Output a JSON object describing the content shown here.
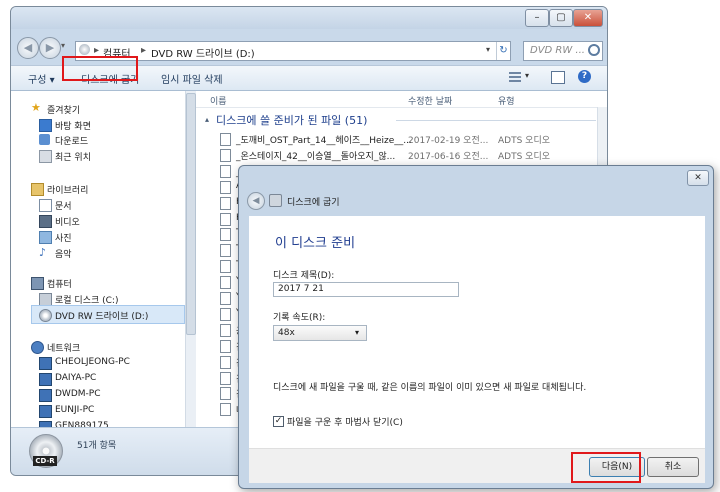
{
  "explorer": {
    "address_parts": [
      "컴퓨터",
      "DVD RW 드라이브 (D:)"
    ],
    "address_sep": "▸",
    "search_placeholder": "DVD RW ...",
    "toolbar": {
      "organize": "구성 ▾",
      "burn": "디스크에 굽기",
      "delete_temp": "임시 파일 삭제"
    },
    "nav": {
      "favorites": {
        "label": "즐겨찾기",
        "items": [
          "바탕 화면",
          "다운로드",
          "최근 위치"
        ]
      },
      "libraries": {
        "label": "라이브러리",
        "items": [
          "문서",
          "비디오",
          "사진",
          "음악"
        ]
      },
      "computer": {
        "label": "컴퓨터",
        "items": [
          "로컬 디스크 (C:)",
          "DVD RW 드라이브 (D:)"
        ]
      },
      "network": {
        "label": "네트워크",
        "items": [
          "CHEOLJEONG-PC",
          "DAIYA-PC",
          "DWDM-PC",
          "EUNJI-PC",
          "GEN889175"
        ]
      }
    },
    "columns": {
      "name": "이름",
      "modified": "수정한 날짜",
      "type": "유형"
    },
    "group_header": "디스크에 쓸 준비가 된 파일 (51)",
    "files": [
      {
        "name": "_도깨비_OST_Part_14__헤이즈__Heize__...",
        "date": "2017-02-19 오전...",
        "type": "ADTS 오디오"
      },
      {
        "name": "_온스테이지_42__이승열__돌아오지_않...",
        "date": "2017-06-16 오전...",
        "type": "ADTS 오디오"
      },
      {
        "name": "_응",
        "date": "",
        "type": ""
      },
      {
        "name": "An",
        "date": "",
        "type": ""
      },
      {
        "name": "Hu",
        "date": "",
        "type": ""
      },
      {
        "name": "Kin",
        "date": "",
        "type": ""
      },
      {
        "name": "The",
        "date": "",
        "type": ""
      },
      {
        "name": "The",
        "date": "",
        "type": ""
      },
      {
        "name": "The",
        "date": "",
        "type": ""
      },
      {
        "name": "Yin",
        "date": "",
        "type": ""
      },
      {
        "name": "You",
        "date": "",
        "type": ""
      },
      {
        "name": "You",
        "date": "",
        "type": ""
      },
      {
        "name": "공항",
        "date": "",
        "type": ""
      },
      {
        "name": "김동",
        "date": "",
        "type": ""
      },
      {
        "name": "김동",
        "date": "",
        "type": ""
      },
      {
        "name": "김동",
        "date": "",
        "type": ""
      },
      {
        "name": "김동",
        "date": "",
        "type": ""
      },
      {
        "name": "나의",
        "date": "",
        "type": ""
      }
    ],
    "status": "51개 항목",
    "disc_label": "CD-R"
  },
  "dialog": {
    "title": "디스크에 굽기",
    "heading": "이 디스크 준비",
    "disc_title_label": "디스크 제목(D):",
    "disc_title_value": "2017 7 21",
    "speed_label": "기록 속도(R):",
    "speed_value": "48x",
    "note": "디스크에 새 파일을 구울 때, 같은 이름의 파일이 이미 있으면 새 파일로 대체됩니다.",
    "close_wizard_label": "파일을 구운 후 마법사 닫기(C)",
    "close_wizard_checked": true,
    "next_button": "다음(N)",
    "cancel_button": "취소"
  },
  "colors": {
    "highlight": "#e0181b",
    "heading": "#1f3c8f",
    "group": "#1e3f8c"
  }
}
